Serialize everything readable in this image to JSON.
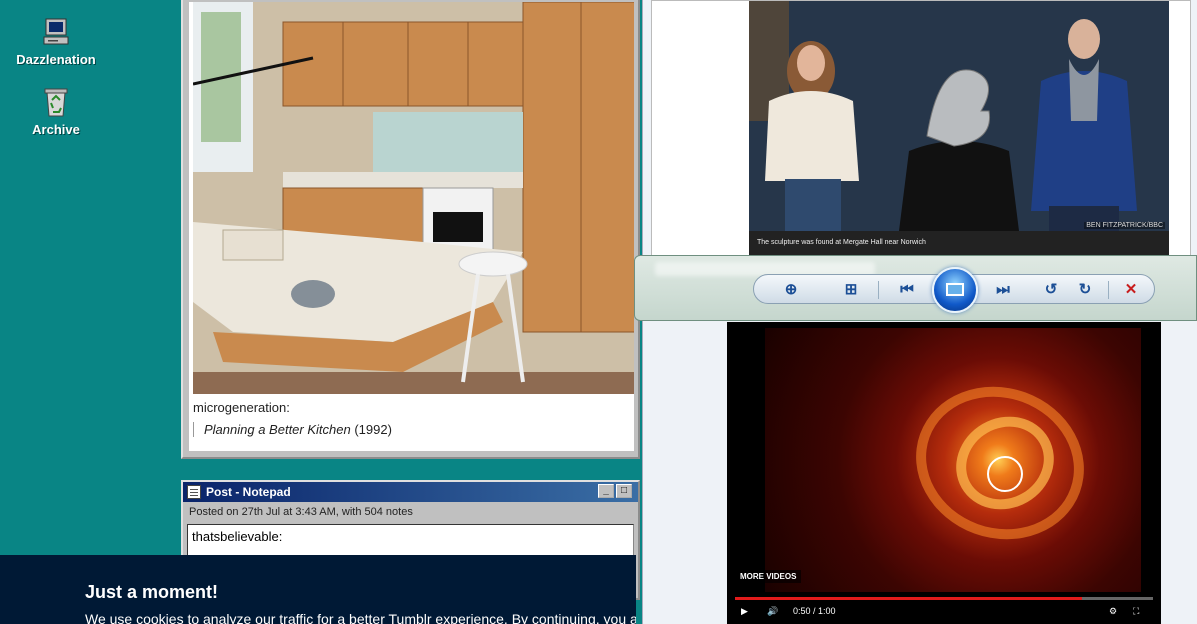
{
  "desktop": {
    "icons": [
      {
        "label": "Dazzlenation",
        "icon": "computer-icon"
      },
      {
        "label": "Archive",
        "icon": "recycle-bin-icon"
      }
    ]
  },
  "post_window": {
    "image": "kitchen-photo",
    "caption": "microgeneration:",
    "quote_title": "Planning a Better Kitchen",
    "quote_year": " (1992)"
  },
  "notepad": {
    "title": "Post - Notepad",
    "meta": "Posted on 27th Jul at 3:43 AM, with 504 notes",
    "body": "thatsbelievable:",
    "buttons": [
      "_",
      "□"
    ]
  },
  "cookie_banner": {
    "heading": "Just a moment!",
    "text": "We use cookies to analyze our traffic for a better Tumblr experience. By continuing, you a"
  },
  "article": {
    "photo_credit": "BEN FITZPATRICK/BBC",
    "photo_caption": "The sculpture was found at Mergate Hall near Norwich"
  },
  "photo_viewer": {
    "buttons": [
      "zoom-icon",
      "actual-size-icon",
      "previous-icon",
      "slideshow-icon",
      "next-icon",
      "rotate-left-icon",
      "rotate-right-icon",
      "delete-icon"
    ]
  },
  "video": {
    "more_videos": "MORE VIDEOS",
    "time": "0:50 / 1:00",
    "progress": 0.83
  },
  "colors": {
    "desktop": "#098585",
    "title_bar": "#0a246a",
    "cookie_bg": "#001935",
    "progress": "#e21b1b"
  }
}
